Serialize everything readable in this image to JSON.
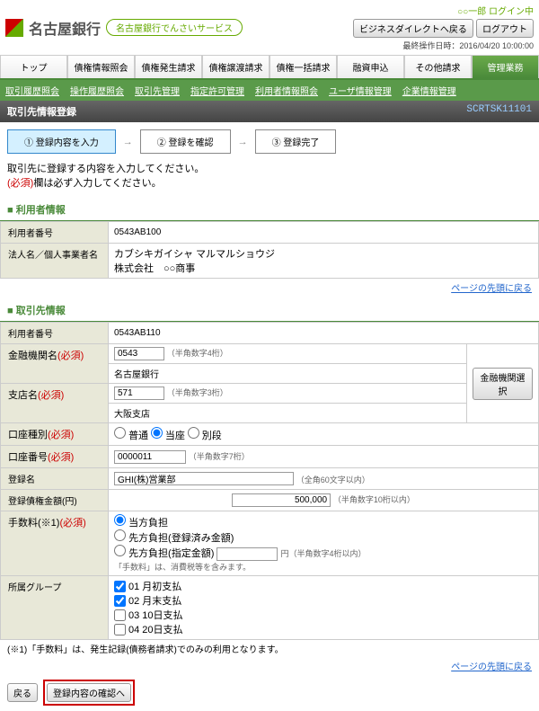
{
  "header": {
    "bank_name": "名古屋銀行",
    "service": "名古屋銀行でんさいサービス",
    "login_status": "○○一郎 ログイン中",
    "btn_back": "ビジネスダイレクトへ戻る",
    "btn_logout": "ログアウト",
    "timestamp": "最終操作日時：2016/04/20 10:00:00"
  },
  "main_tabs": [
    "トップ",
    "債権情報照会",
    "債権発生請求",
    "債権譲渡請求",
    "債権一括請求",
    "融資申込",
    "その他請求",
    "管理業務"
  ],
  "sub_tabs": [
    "取引履歴照会",
    "操作履歴照会",
    "取引先管理",
    "指定許可管理",
    "利用者情報照会",
    "ユーザ情報管理",
    "企業情報管理"
  ],
  "page_title": "取引先情報登録",
  "screen_id": "SCRTSK11101",
  "steps": {
    "s1": "① 登録内容を入力",
    "s2": "② 登録を確認",
    "s3": "③ 登録完了",
    "arrow": "→"
  },
  "instruct": {
    "l1": "取引先に登録する内容を入力してください。",
    "l2": "(必須)欄は必ず入力してください。"
  },
  "sec1": {
    "title": "利用者情報",
    "r1_label": "利用者番号",
    "r1_val": "0543AB100",
    "r2_label": "法人名／個人事業者名",
    "r2_val1": "カブシキガイシャ マルマルショウジ",
    "r2_val2": "株式会社　○○商事"
  },
  "back_link": "ページの先頭に戻る",
  "sec2": {
    "title": "取引先情報",
    "user_no_label": "利用者番号",
    "user_no": "0543AB110",
    "fin_label": "金融機関名",
    "fin_code": "0543",
    "fin_hint": "（半角数字4桁）",
    "fin_name": "名古屋銀行",
    "fin_btn": "金融機関選択",
    "branch_label": "支店名",
    "branch_code": "571",
    "branch_hint": "（半角数字3桁）",
    "branch_name": "大阪支店",
    "acct_type_label": "口座種別",
    "acct_opts": [
      "普通",
      "当座",
      "別段"
    ],
    "acct_no_label": "口座番号",
    "acct_no": "0000011",
    "acct_hint": "（半角数字7桁）",
    "reg_name_label": "登録名",
    "reg_name": "GHI(株)営業部",
    "reg_name_hint": "（全角60文字以内）",
    "amount_label": "登録債権金額(円)",
    "amount": "500,000",
    "amount_hint": "（半角数字10桁以内）",
    "fee_label": "手数料(※1)",
    "fee_opts": [
      "当方負担",
      "先方負担(登録済み金額)",
      "先方負担(指定金額)"
    ],
    "fee_input_hint": "円（半角数字4桁以内）",
    "fee_note": "「手数料」は、消費税等を含みます。",
    "group_label": "所属グループ",
    "groups": [
      "01 月初支払",
      "02 月末支払",
      "03 10日支払",
      "04 20日支払"
    ]
  },
  "note": "(※1)「手数料」は、発生記録(債務者請求)でのみの利用となります。",
  "footer": {
    "back": "戻る",
    "submit": "登録内容の確認へ"
  },
  "req": "(必須)"
}
